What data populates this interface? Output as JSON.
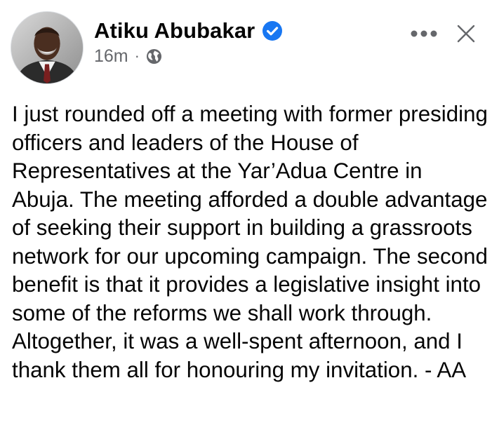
{
  "post": {
    "author": {
      "name": "Atiku Abubakar",
      "verified": true,
      "avatar_icon": "profile-photo"
    },
    "timestamp": "16m",
    "separator": "·",
    "audience_icon": "globe-icon",
    "actions": {
      "more_icon": "more-options-icon",
      "close_icon": "close-icon"
    },
    "body_text": "I just rounded off a meeting with former presiding officers and leaders of the House of Representatives at the Yar’Adua Centre in Abuja. The meeting afforded a double advantage of seeking their support in building a grassroots network for our upcoming campaign. The second benefit is that it provides a legislative insight into some of the reforms we shall work through. Altogether, it was a well-spent afternoon, and I thank them all for honouring my invitation. - AA"
  },
  "colors": {
    "text_primary": "#050505",
    "text_secondary": "#65676b",
    "verified_badge": "#1877f2",
    "icon_gray": "#65676b",
    "background": "#ffffff"
  }
}
